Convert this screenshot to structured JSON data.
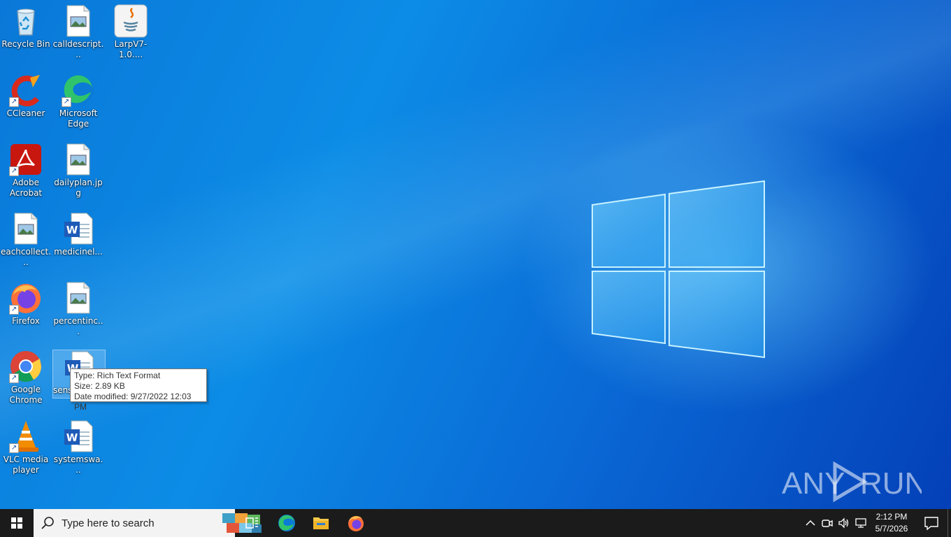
{
  "desktop": {
    "icons": [
      {
        "label": "Recycle Bin",
        "icon": "recycle-bin-icon"
      },
      {
        "label": "calldescript...",
        "icon": "image-file-icon"
      },
      {
        "label": "LarpV7-1.0....",
        "icon": "java-icon"
      },
      {
        "label": "CCleaner",
        "icon": "ccleaner-icon"
      },
      {
        "label": "Microsoft Edge",
        "icon": "edge-icon"
      },
      {
        "label": "Adobe Acrobat",
        "icon": "acrobat-icon"
      },
      {
        "label": "dailyplan.jpg",
        "icon": "image-file-icon"
      },
      {
        "label": "eachcollect...",
        "icon": "image-file-icon"
      },
      {
        "label": "medicinel...",
        "icon": "word-doc-icon"
      },
      {
        "label": "Firefox",
        "icon": "firefox-icon"
      },
      {
        "label": "percentinc...",
        "icon": "image-file-icon"
      },
      {
        "label": "Google Chrome",
        "icon": "chrome-icon"
      },
      {
        "label": "sens",
        "icon": "word-doc-icon"
      },
      {
        "label": "VLC media player",
        "icon": "vlc-icon"
      },
      {
        "label": "systemswa...",
        "icon": "word-doc-icon"
      }
    ]
  },
  "tooltip": {
    "type": "Type: Rich Text Format",
    "size": "Size: 2.89 KB",
    "modified": "Date modified: 9/27/2022 12:03 PM"
  },
  "watermark": {
    "text": "ANY RUN"
  },
  "taskbar": {
    "search_placeholder": "Type here to search",
    "time": "2:12 PM",
    "date": "5/7/2026"
  },
  "colors": {
    "taskbar": "#1b1b1b",
    "desktop_blue": "#0a78d8"
  }
}
